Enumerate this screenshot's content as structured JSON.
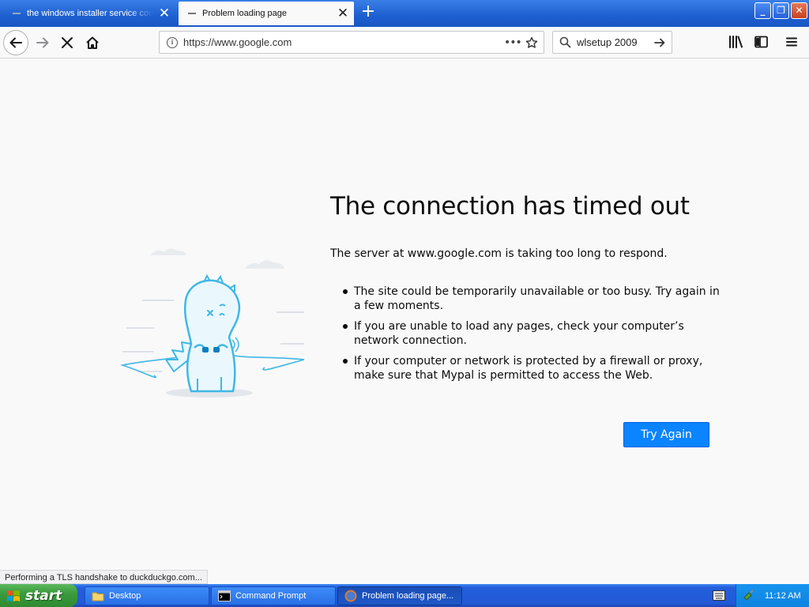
{
  "browser": {
    "tabs": [
      {
        "title": "the windows installer service could not be accessed",
        "active": false
      },
      {
        "title": "Problem loading page",
        "active": true
      }
    ],
    "url": "https://www.google.com",
    "search_value": "wlsetup 2009"
  },
  "error_page": {
    "title": "The connection has timed out",
    "description": "The server at www.google.com is taking too long to respond.",
    "bullets": [
      "The site could be temporarily unavailable or too busy. Try again in a few moments.",
      "If you are unable to load any pages, check your computer’s network connection.",
      "If your computer or network is protected by a firewall or proxy, make sure that Mypal is permitted to access the Web."
    ],
    "try_again_label": "Try Again"
  },
  "status_text": "Performing a TLS handshake to duckduckgo.com...",
  "taskbar": {
    "start_label": "start",
    "items": [
      "Desktop",
      "Command Prompt",
      "Problem loading page..."
    ],
    "clock": "11:12 AM"
  },
  "colors": {
    "accent": "#0a84ff",
    "taskbar": "#245edb",
    "start_green": "#3c9b3e"
  }
}
